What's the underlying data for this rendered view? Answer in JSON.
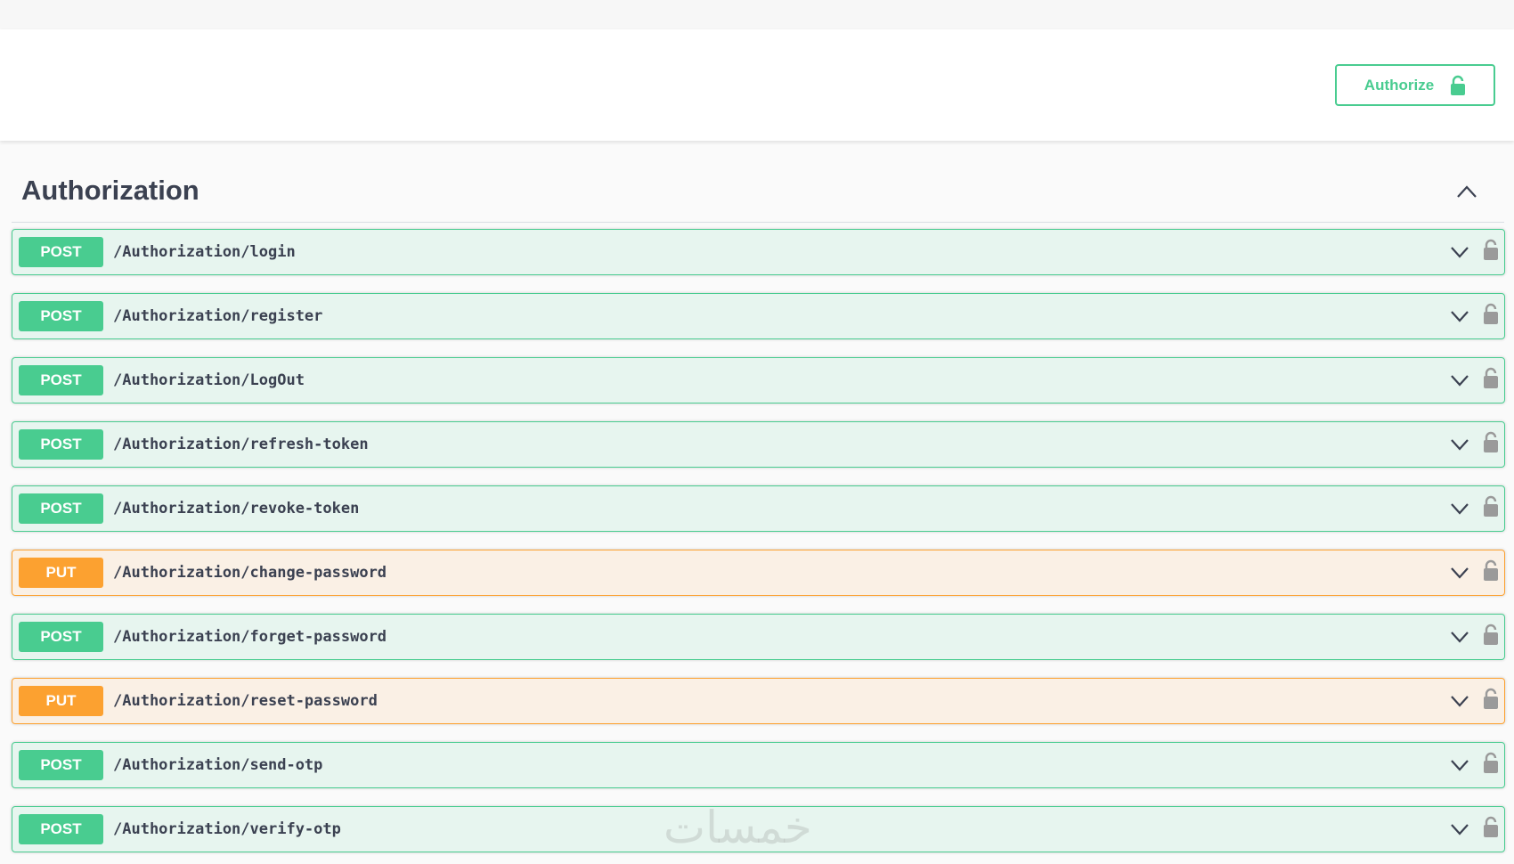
{
  "header": {
    "authorize_label": "Authorize",
    "lock_icon": "lock-open-icon"
  },
  "section": {
    "title": "Authorization",
    "toggle_icon": "chevron-up-icon"
  },
  "colors": {
    "post": "#49cc90",
    "put": "#fca130",
    "text": "#3b4151"
  },
  "operations": [
    {
      "method": "POST",
      "path": "/Authorization/login"
    },
    {
      "method": "POST",
      "path": "/Authorization/register"
    },
    {
      "method": "POST",
      "path": "/Authorization/LogOut"
    },
    {
      "method": "POST",
      "path": "/Authorization/refresh-token"
    },
    {
      "method": "POST",
      "path": "/Authorization/revoke-token"
    },
    {
      "method": "PUT",
      "path": "/Authorization/change-password"
    },
    {
      "method": "POST",
      "path": "/Authorization/forget-password"
    },
    {
      "method": "PUT",
      "path": "/Authorization/reset-password"
    },
    {
      "method": "POST",
      "path": "/Authorization/send-otp"
    },
    {
      "method": "POST",
      "path": "/Authorization/verify-otp"
    }
  ],
  "watermark": "خمسات"
}
